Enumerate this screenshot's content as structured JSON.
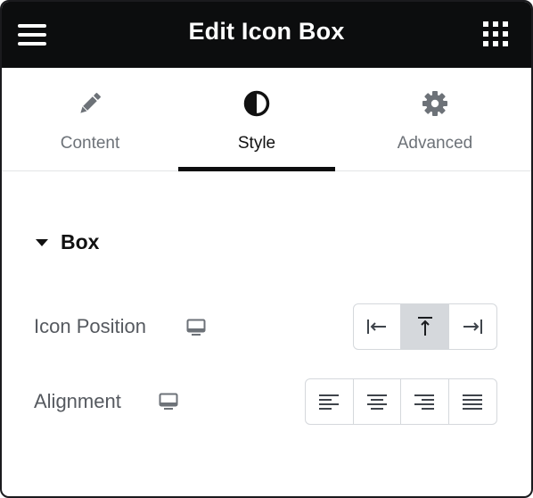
{
  "header": {
    "title": "Edit Icon Box",
    "menu_icon": "hamburger-icon",
    "apps_icon": "grid-icon"
  },
  "tabs": [
    {
      "label": "Content",
      "icon": "pencil-icon",
      "active": false
    },
    {
      "label": "Style",
      "icon": "half-circle-icon",
      "active": true
    },
    {
      "label": "Advanced",
      "icon": "gear-icon",
      "active": false
    }
  ],
  "section": {
    "title": "Box",
    "expanded": true
  },
  "controls": {
    "icon_position": {
      "label": "Icon Position",
      "responsive_icon": "desktop-icon",
      "options": [
        "left",
        "top",
        "right"
      ],
      "selected": "top"
    },
    "alignment": {
      "label": "Alignment",
      "responsive_icon": "desktop-icon",
      "options": [
        "left",
        "center",
        "right",
        "justify"
      ],
      "selected": null
    }
  },
  "colors": {
    "header_bg": "#0c0d0e",
    "selected_bg": "#d5d8dc",
    "muted_text": "#6d7278"
  }
}
